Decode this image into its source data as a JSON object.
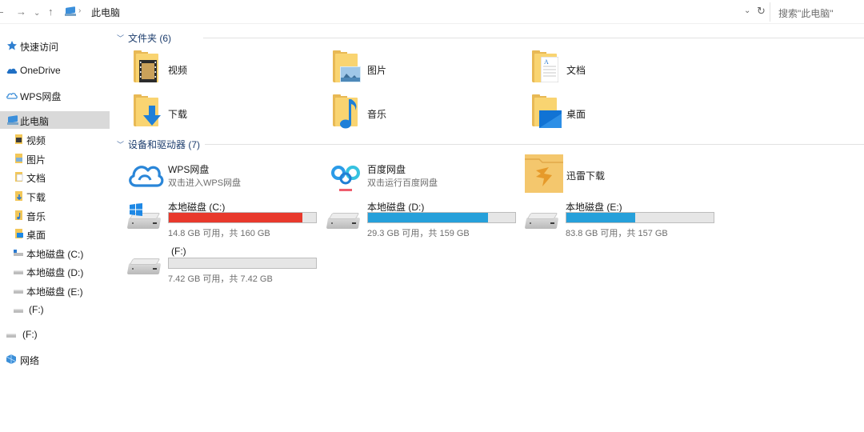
{
  "address": {
    "breadcrumb_separator": "›",
    "location": "此电脑",
    "search_placeholder": "搜索\"此电脑\""
  },
  "sidebar": {
    "items": [
      {
        "label": "快速访问",
        "icon": "star-icon"
      },
      {
        "label": "OneDrive",
        "icon": "cloud-icon"
      },
      {
        "label": "WPS网盘",
        "icon": "cloud-outline-icon"
      },
      {
        "label": "此电脑",
        "icon": "computer-icon",
        "selected": true
      },
      {
        "label": "视频",
        "icon": "folder-videos-icon"
      },
      {
        "label": "图片",
        "icon": "folder-pictures-icon"
      },
      {
        "label": "文档",
        "icon": "folder-documents-icon"
      },
      {
        "label": "下载",
        "icon": "folder-downloads-icon"
      },
      {
        "label": "音乐",
        "icon": "folder-music-icon"
      },
      {
        "label": "桌面",
        "icon": "folder-desktop-icon"
      },
      {
        "label": "本地磁盘 (C:)",
        "icon": "drive-icon"
      },
      {
        "label": "本地磁盘 (D:)",
        "icon": "drive-icon"
      },
      {
        "label": "本地磁盘 (E:)",
        "icon": "drive-icon"
      },
      {
        "label": "(F:)",
        "icon": "drive-icon"
      },
      {
        "label": "(F:)",
        "icon": "drive-icon"
      },
      {
        "label": "网络",
        "icon": "network-icon"
      }
    ]
  },
  "folders_group": {
    "title": "文件夹 (6)",
    "items": [
      {
        "label": "视频",
        "icon": "folder-videos-icon"
      },
      {
        "label": "图片",
        "icon": "folder-pictures-icon"
      },
      {
        "label": "文档",
        "icon": "folder-documents-icon"
      },
      {
        "label": "下载",
        "icon": "folder-downloads-icon"
      },
      {
        "label": "音乐",
        "icon": "folder-music-icon"
      },
      {
        "label": "桌面",
        "icon": "folder-desktop-icon"
      }
    ]
  },
  "devices_group": {
    "title": "设备和驱动器 (7)",
    "apps": [
      {
        "name": "WPS网盘",
        "desc": "双击进入WPS网盘",
        "icon": "wps-cloud-icon"
      },
      {
        "name": "百度网盘",
        "desc": "双击运行百度网盘",
        "icon": "baidu-netdisk-icon"
      },
      {
        "name": "迅雷下载",
        "icon": "xunlei-icon"
      }
    ],
    "drives": [
      {
        "name": "本地磁盘 (C:)",
        "capacity": "14.8 GB 可用，共 160 GB",
        "used_fraction": 0.9075,
        "bar_color": "#e8392c"
      },
      {
        "name": "本地磁盘 (D:)",
        "capacity": "29.3 GB 可用，共 159 GB",
        "used_fraction": 0.8157,
        "bar_color": "#26a0da"
      },
      {
        "name": "本地磁盘 (E:)",
        "capacity": "83.8 GB 可用，共 157 GB",
        "used_fraction": 0.4662,
        "bar_color": "#26a0da"
      },
      {
        "name": "(F:)",
        "capacity": "7.42 GB 可用，共 7.42 GB",
        "used_fraction": 0.0,
        "bar_color": "#26a0da"
      }
    ]
  }
}
